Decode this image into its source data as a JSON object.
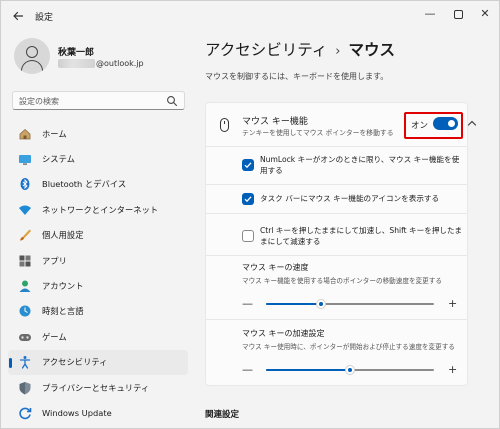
{
  "window": {
    "title": "設定",
    "back_icon": "arrow-left-icon",
    "controls": {
      "minimize": "—",
      "close": "✕"
    }
  },
  "profile": {
    "name": "秋葉一郎",
    "email_suffix": "@outlook.jp"
  },
  "search": {
    "placeholder": "設定の検索"
  },
  "nav": {
    "items": [
      {
        "label": "ホーム",
        "icon": "home-icon"
      },
      {
        "label": "システム",
        "icon": "system-icon"
      },
      {
        "label": "Bluetooth とデバイス",
        "icon": "bluetooth-icon"
      },
      {
        "label": "ネットワークとインターネット",
        "icon": "network-icon"
      },
      {
        "label": "個人用設定",
        "icon": "personalization-icon"
      },
      {
        "label": "アプリ",
        "icon": "apps-icon"
      },
      {
        "label": "アカウント",
        "icon": "account-icon"
      },
      {
        "label": "時刻と言語",
        "icon": "time-language-icon"
      },
      {
        "label": "ゲーム",
        "icon": "gaming-icon"
      },
      {
        "label": "アクセシビリティ",
        "icon": "accessibility-icon",
        "active": true
      },
      {
        "label": "プライバシーとセキュリティ",
        "icon": "privacy-shield-icon"
      },
      {
        "label": "Windows Update",
        "icon": "windows-update-icon"
      }
    ]
  },
  "main": {
    "breadcrumb": {
      "parent": "アクセシビリティ",
      "separator": "›",
      "current": "マウス"
    },
    "description": "マウスを制御するには、キーボードを使用します。",
    "mouse_keys": {
      "title": "マウス キー機能",
      "subtitle": "テンキーを使用してマウス ポインターを移動する",
      "toggle_state_label": "オン",
      "enabled": true
    },
    "options": [
      {
        "label": "NumLock キーがオンのときに限り、マウス キー機能を使用する",
        "checked": true
      },
      {
        "label": "タスク バーにマウス キー機能のアイコンを表示する",
        "checked": true
      },
      {
        "label": "Ctrl キーを押したままにして加速し、Shift キーを押したままにして減速する",
        "checked": false
      }
    ],
    "speed": {
      "title": "マウス キーの速度",
      "subtitle": "マウス キー機能を使用する場合のポインターの移動速度を変更する",
      "minus": "—",
      "plus": "+",
      "value_fraction": 0.33
    },
    "acceleration": {
      "title": "マウス キーの加速設定",
      "subtitle": "マウス キー使用時に、ポインターが開始および停止する速度を変更する",
      "minus": "—",
      "plus": "+",
      "value_fraction": 0.5
    },
    "related_title": "関連設定"
  },
  "colors": {
    "accent": "#005fb8",
    "highlight_border": "#e00000",
    "background": "#f3f3f3",
    "card": "#fbfbfb"
  }
}
